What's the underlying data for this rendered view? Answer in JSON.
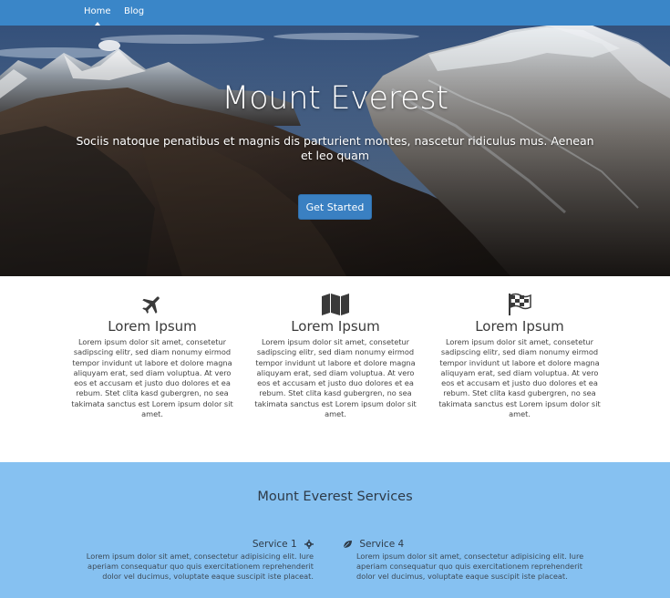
{
  "nav": {
    "items": [
      {
        "label": "Home",
        "active": true
      },
      {
        "label": "Blog",
        "active": false
      }
    ]
  },
  "hero": {
    "title": "Mount Everest",
    "subtitle": "Sociis natoque penatibus et magnis dis parturient montes, nascetur ridiculus mus. Aenean et leo quam",
    "button_label": "Get Started"
  },
  "features": [
    {
      "icon": "airplane-icon",
      "title": "Lorem Ipsum",
      "text": "Lorem ipsum dolor sit amet, consetetur sadipscing elitr, sed diam nonumy eirmod tempor invidunt ut labore et dolore magna aliquyam erat, sed diam voluptua. At vero eos et accusam et justo duo dolores et ea rebum. Stet clita kasd gubergren, no sea takimata sanctus est Lorem ipsum dolor sit amet."
    },
    {
      "icon": "map-icon",
      "title": "Lorem Ipsum",
      "text": "Lorem ipsum dolor sit amet, consetetur sadipscing elitr, sed diam nonumy eirmod tempor invidunt ut labore et dolore magna aliquyam erat, sed diam voluptua. At vero eos et accusam et justo duo dolores et ea rebum. Stet clita kasd gubergren, no sea takimata sanctus est Lorem ipsum dolor sit amet."
    },
    {
      "icon": "checkered-flag-icon",
      "title": "Lorem Ipsum",
      "text": "Lorem ipsum dolor sit amet, consetetur sadipscing elitr, sed diam nonumy eirmod tempor invidunt ut labore et dolore magna aliquyam erat, sed diam voluptua. At vero eos et accusam et justo duo dolores et ea rebum. Stet clita kasd gubergren, no sea takimata sanctus est Lorem ipsum dolor sit amet."
    }
  ],
  "services": {
    "title": "Mount Everest Services",
    "items": [
      {
        "name": "Service 1",
        "icon": "gear-icon",
        "text": "Lorem ipsum dolor sit amet, consectetur adipisicing elit. Iure aperiam consequatur quo quis exercitationem reprehenderit dolor vel ducimus, voluptate eaque suscipit iste placeat."
      },
      {
        "name": "Service 4",
        "icon": "leaf-icon",
        "text": "Lorem ipsum dolor sit amet, consectetur adipisicing elit. Iure aperiam consequatur quo quis exercitationem reprehenderit dolor vel ducimus, voluptate eaque suscipit iste placeat."
      }
    ]
  },
  "colors": {
    "navbar": "#3a86c8",
    "button": "#3a80c2",
    "services_bg": "#86c1f1"
  }
}
